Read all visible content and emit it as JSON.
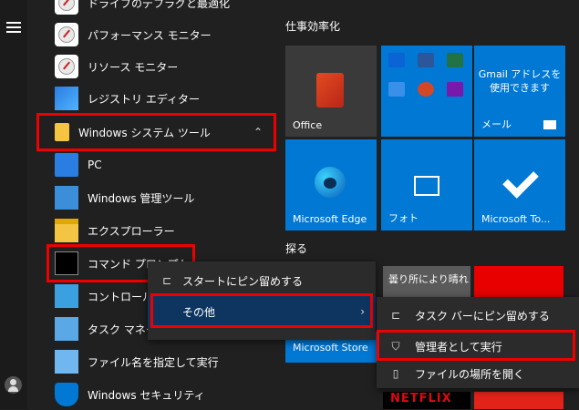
{
  "app_list": {
    "items": [
      {
        "label": "ドライブのデフラグと最適化",
        "icon": "disk-gauge-icon"
      },
      {
        "label": "パフォーマンス モニター",
        "icon": "gauge-icon"
      },
      {
        "label": "リソース モニター",
        "icon": "gauge-icon"
      },
      {
        "label": "レジストリ エディター",
        "icon": "registry-icon"
      },
      {
        "label": "Windows システム ツール",
        "icon": "folder-icon"
      },
      {
        "label": "PC",
        "icon": "pc-icon"
      },
      {
        "label": "Windows 管理ツール",
        "icon": "admin-tools-icon"
      },
      {
        "label": "エクスプローラー",
        "icon": "explorer-icon"
      },
      {
        "label": "コマンド プロンプト",
        "icon": "cmd-icon"
      },
      {
        "label": "コントロール パネル",
        "icon": "control-panel-icon"
      },
      {
        "label": "タスク マネージャー",
        "icon": "task-manager-icon"
      },
      {
        "label": "ファイル名を指定して実行",
        "icon": "run-icon"
      },
      {
        "label": "Windows セキュリティ",
        "icon": "shield-icon"
      }
    ]
  },
  "tiles": {
    "section1": "仕事効率化",
    "section2": "探る",
    "office": "Office",
    "gmail": "Gmail アドレスを使用できます",
    "mail": "メール",
    "edge": "Microsoft Edge",
    "photos": "フォト",
    "todo": "Microsoft To...",
    "store": "Microsoft Store",
    "weather": "曇り所により晴れ",
    "netflix": "NETFLIX"
  },
  "context_menu": {
    "pin_start": "スタートにピン留めする",
    "more": "その他"
  },
  "more_menu": {
    "pin_taskbar": "タスク バーにピン留めする",
    "run_as_admin": "管理者として実行",
    "open_location": "ファイルの場所を開く"
  },
  "colors": {
    "accent": "#0078d4",
    "highlight": "#0d3560",
    "red_outline": "#e00000"
  }
}
